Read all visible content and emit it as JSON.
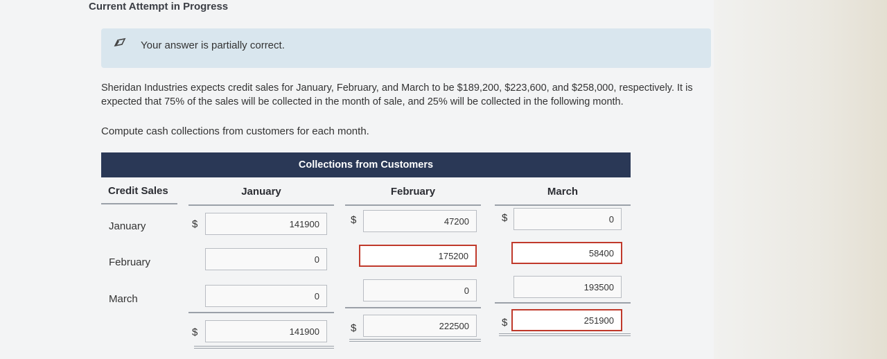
{
  "page": {
    "title": "Current Attempt in Progress"
  },
  "feedback": {
    "icon": "pencil-icon",
    "text": "Your answer is partially correct."
  },
  "problem": {
    "line1": "Sheridan Industries expects credit sales for January, February, and March to be $189,200, $223,600, and $258,000, respectively. It is",
    "line2": "expected that 75% of the sales will be collected in the month of sale, and 25% will be collected in the following month.",
    "instruction": "Compute cash collections from customers for each month."
  },
  "table": {
    "title": "Collections from Customers",
    "row_header": "Credit Sales",
    "columns": [
      "January",
      "February",
      "March"
    ],
    "rows": [
      {
        "label": "January",
        "values": [
          "141900",
          "47200",
          "0"
        ]
      },
      {
        "label": "February",
        "values": [
          "0",
          "175200",
          "58400"
        ]
      },
      {
        "label": "March",
        "values": [
          "0",
          "0",
          "193500"
        ]
      }
    ],
    "totals": [
      "141900",
      "222500",
      "251900"
    ],
    "currency": "$"
  },
  "colors": {
    "header_bg": "#2a3856",
    "feedback_bg": "#d9e6ee",
    "error_border": "#c0392b"
  }
}
